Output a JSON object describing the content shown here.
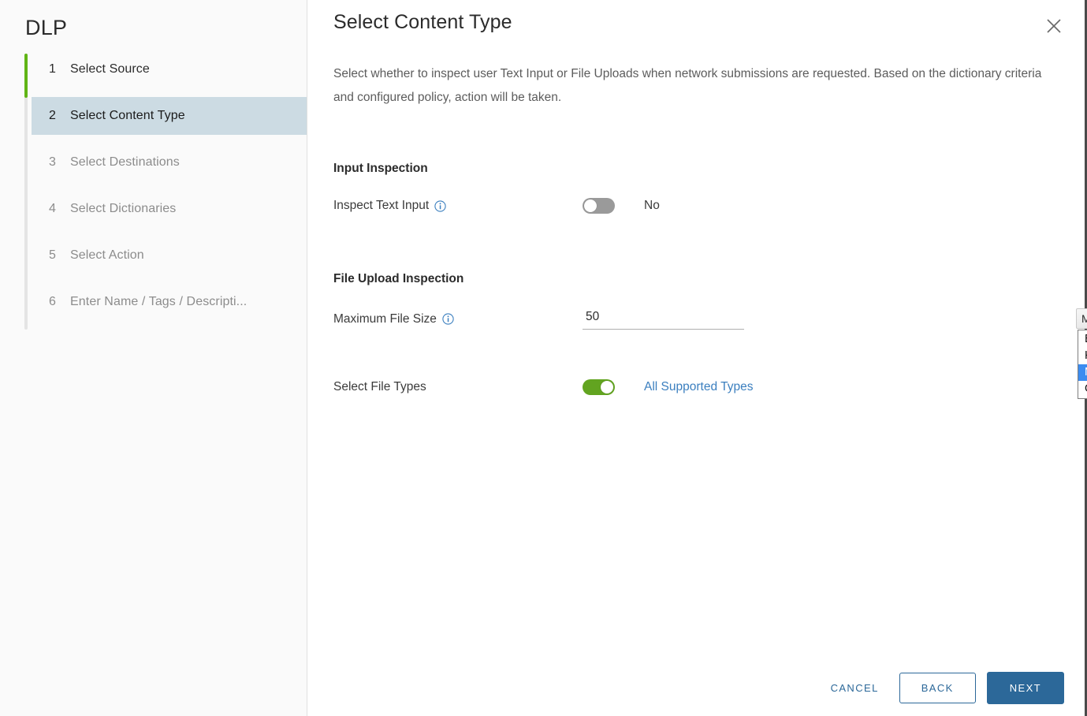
{
  "sidebar": {
    "title": "DLP",
    "steps": [
      {
        "num": "1",
        "label": "Select Source",
        "state": "done"
      },
      {
        "num": "2",
        "label": "Select Content Type",
        "state": "current"
      },
      {
        "num": "3",
        "label": "Select Destinations",
        "state": "upcoming"
      },
      {
        "num": "4",
        "label": "Select Dictionaries",
        "state": "upcoming"
      },
      {
        "num": "5",
        "label": "Select Action",
        "state": "upcoming"
      },
      {
        "num": "6",
        "label": "Enter Name / Tags / Descripti...",
        "state": "upcoming"
      }
    ]
  },
  "header": {
    "title": "Select Content Type",
    "close_icon": "close-icon"
  },
  "main": {
    "intro": "Select whether to inspect user Text Input or File Uploads when network submissions are requested. Based on the dictionary criteria and configured policy, action will be taken.",
    "input_inspection": {
      "heading": "Input Inspection",
      "inspect_text_input": {
        "label": "Inspect Text Input",
        "info_icon": "info-icon",
        "toggle_state": "off",
        "value": "No"
      }
    },
    "file_upload_inspection": {
      "heading": "File Upload Inspection",
      "maximum_file_size": {
        "label": "Maximum File Size",
        "info_icon": "info-icon",
        "value": "50",
        "placeholder": ""
      },
      "unit_select": {
        "selected": "MB",
        "caret_icon": "chevron-down-icon",
        "options": [
          "B",
          "KB",
          "MB",
          "GB"
        ]
      },
      "select_file_types": {
        "label": "Select File Types",
        "toggle_state": "on",
        "value": "All Supported Types"
      }
    }
  },
  "footer": {
    "cancel_label": "CANCEL",
    "back_label": "BACK",
    "next_label": "NEXT"
  },
  "colors": {
    "accent_blue": "#2c6899",
    "step_active_green": "#60b515",
    "toggle_on_green": "#62a420",
    "current_step_bg": "#ccdbe3",
    "option_highlight": "#3c8cf0",
    "link_blue": "#3b7fbf"
  }
}
